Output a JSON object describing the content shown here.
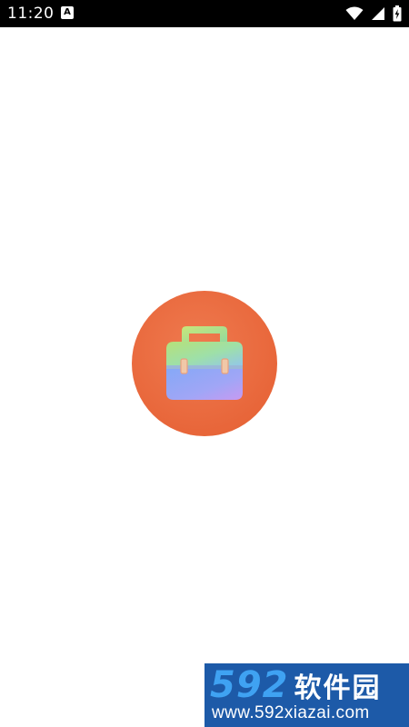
{
  "status_bar": {
    "time": "11:20",
    "notification_icon_glyph": "A",
    "icons": [
      "wifi-icon",
      "signal-icon",
      "battery-charging-icon"
    ]
  },
  "splash": {
    "logo_icon": "toolbox-icon",
    "colors": {
      "circle": "#e8663a",
      "handle": "#a8dc7a",
      "body_top": "#9ee09a",
      "body_bottom": "#8fb0f5",
      "body_accent": "#c59af0"
    }
  },
  "watermark": {
    "brand_number": "592",
    "brand_name": "软件园",
    "url": "www.592xiazai.com",
    "colors": {
      "background": "#1d5aa8",
      "number": "#3fa2f2",
      "text": "#ffffff"
    }
  }
}
